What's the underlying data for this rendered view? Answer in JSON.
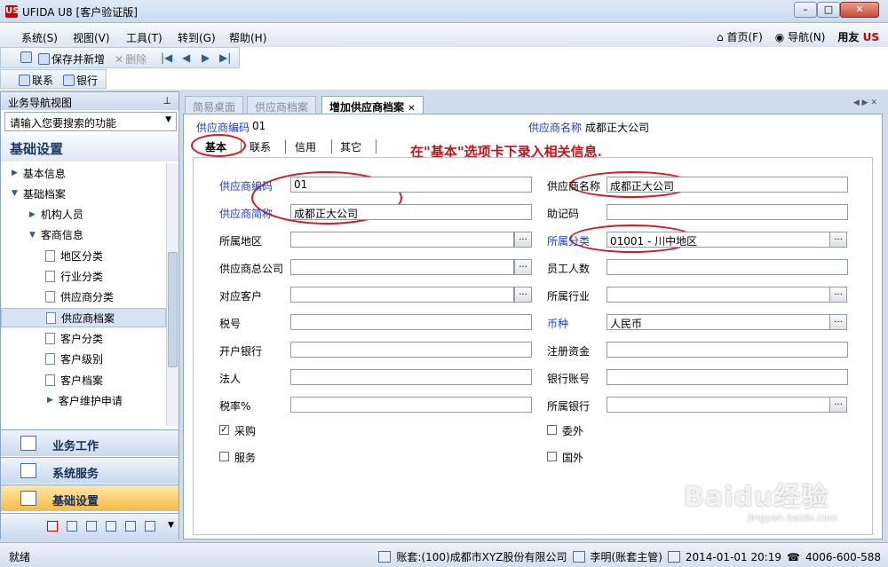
{
  "window": {
    "title": "UFIDA U8 [客户验证版]",
    "logo": "US",
    "min": "–",
    "max": "□",
    "close": "✕"
  },
  "menu": {
    "items": [
      "系统(S)",
      "视图(V)",
      "工具(T)",
      "转到(G)",
      "帮助(H)"
    ],
    "home": "首页(F)",
    "navigate": "导航(N)",
    "brand_text": "用友",
    "brand_mark": "US"
  },
  "toolbar": {
    "save_new": "保存并新增",
    "delete": "删除",
    "contact": "联系",
    "bank": "银行"
  },
  "nav": {
    "header": "业务导航视图",
    "pin": "ᵖ",
    "search_placeholder": "请输入您要搜索的功能",
    "section": "基础设置",
    "tree": [
      {
        "label": "基本信息",
        "level": 0,
        "type": "collapsed"
      },
      {
        "label": "基础档案",
        "level": 0,
        "type": "expanded"
      },
      {
        "label": "机构人员",
        "level": 1,
        "type": "collapsed"
      },
      {
        "label": "客商信息",
        "level": 1,
        "type": "expanded"
      },
      {
        "label": "地区分类",
        "level": 2,
        "type": "doc"
      },
      {
        "label": "行业分类",
        "level": 2,
        "type": "doc"
      },
      {
        "label": "供应商分类",
        "level": 2,
        "type": "doc"
      },
      {
        "label": "供应商档案",
        "level": 2,
        "type": "doc",
        "selected": true
      },
      {
        "label": "客户分类",
        "level": 2,
        "type": "doc"
      },
      {
        "label": "客户级别",
        "level": 2,
        "type": "doc"
      },
      {
        "label": "客户档案",
        "level": 2,
        "type": "doc"
      },
      {
        "label": "客户维护申请",
        "level": 2,
        "type": "collapsed"
      }
    ],
    "buttons": {
      "business": "业务工作",
      "system": "系统服务",
      "base": "基础设置"
    }
  },
  "tabs": [
    "简易桌面",
    "供应商档案",
    "增加供应商档案"
  ],
  "header": {
    "code_label": "供应商编码",
    "code_value": "01",
    "name_label": "供应商名称",
    "name_value": "成都正大公司"
  },
  "subtabs": [
    "基本",
    "联系",
    "信用",
    "其它"
  ],
  "instruction": "在\"基本\"选项卡下录入相关信息.",
  "form": {
    "left": [
      {
        "label": "供应商编码",
        "value": "01",
        "required": true,
        "ref": false
      },
      {
        "label": "供应商简称",
        "value": "成都正大公司",
        "required": true,
        "ref": false
      },
      {
        "label": "所属地区",
        "value": "",
        "required": false,
        "ref": true
      },
      {
        "label": "供应商总公司",
        "value": "",
        "required": false,
        "ref": true
      },
      {
        "label": "对应客户",
        "value": "",
        "required": false,
        "ref": true
      },
      {
        "label": "税号",
        "value": "",
        "required": false,
        "ref": false
      },
      {
        "label": "开户银行",
        "value": "",
        "required": false,
        "ref": false
      },
      {
        "label": "法人",
        "value": "",
        "required": false,
        "ref": false
      },
      {
        "label": "税率%",
        "value": "",
        "required": false,
        "ref": false
      }
    ],
    "right": [
      {
        "label": "供应商名称",
        "value": "成都正大公司",
        "required": false,
        "ref": false
      },
      {
        "label": "助记码",
        "value": "",
        "required": false,
        "ref": false
      },
      {
        "label": "所属分类",
        "value": "01001 - 川中地区",
        "required": true,
        "ref": true
      },
      {
        "label": "员工人数",
        "value": "",
        "required": false,
        "ref": false
      },
      {
        "label": "所属行业",
        "value": "",
        "required": false,
        "ref": true
      },
      {
        "label": "币种",
        "value": "人民币",
        "required": true,
        "ref": true
      },
      {
        "label": "注册资金",
        "value": "",
        "required": false,
        "ref": false
      },
      {
        "label": "银行账号",
        "value": "",
        "required": false,
        "ref": false
      },
      {
        "label": "所属银行",
        "value": "",
        "required": false,
        "ref": true
      }
    ],
    "checkboxes": [
      {
        "label": "采购",
        "checked": true
      },
      {
        "label": "委外",
        "checked": false
      },
      {
        "label": "服务",
        "checked": false
      },
      {
        "label": "国外",
        "checked": false
      }
    ],
    "ref_button": "..."
  },
  "status": {
    "ready": "就绪",
    "account": "账套:(100)成都市XYZ股份有限公司",
    "user": "李明(账套主管)",
    "datetime": "2014-01-01 20:19",
    "phone": "4006-600-588"
  },
  "watermark": {
    "main": "Baidu经验",
    "sub": "jingyan.baidu.com"
  }
}
